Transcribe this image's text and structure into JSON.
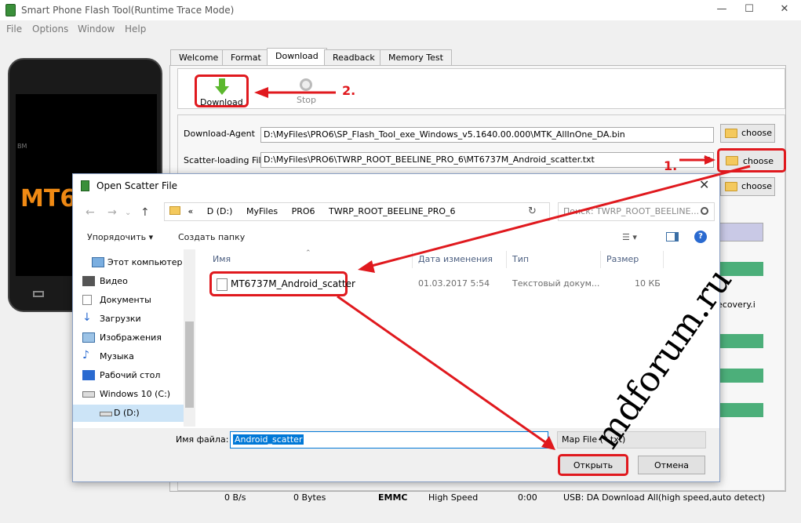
{
  "window": {
    "title": "Smart Phone Flash Tool(Runtime Trace Mode)"
  },
  "menu": [
    "File",
    "Options",
    "Window",
    "Help"
  ],
  "phone": {
    "brand": "BM",
    "chip": "MT6"
  },
  "tabs": [
    "Welcome",
    "Format",
    "Download",
    "Readback",
    "Memory Test"
  ],
  "toolbar": {
    "download": "Download",
    "stop": "Stop"
  },
  "annotations": {
    "step1": "1.",
    "step2": "2."
  },
  "fields": {
    "download_agent_label": "Download-Agent",
    "download_agent_value": "D:\\MyFiles\\PRO6\\SP_Flash_Tool_exe_Windows_v5.1640.00.000\\MTK_AllInOne_DA.bin",
    "scatter_label": "Scatter-loading File",
    "scatter_value": "D:\\MyFiles\\PRO6\\TWRP_ROOT_BEELINE_PRO_6\\MT6737M_Android_scatter.txt",
    "choose": "choose"
  },
  "partition_hint": "ecovery.i",
  "status": {
    "speed": "0 B/s",
    "bytes": "0 Bytes",
    "storage": "EMMC",
    "mode": "High Speed",
    "time": "0:00",
    "usb": "USB: DA Download All(high speed,auto detect)"
  },
  "dialog": {
    "title": "Open Scatter File",
    "path": [
      "«",
      "D (D:)",
      "MyFiles",
      "PRO6",
      "TWRP_ROOT_BEELINE_PRO_6"
    ],
    "search_placeholder": "Поиск: TWRP_ROOT_BEELINE...",
    "organize": "Упорядочить ▾",
    "new_folder": "Создать папку",
    "nav": [
      "Этот компьютер",
      "Видео",
      "Документы",
      "Загрузки",
      "Изображения",
      "Музыка",
      "Рабочий стол",
      "Windows 10 (C:)",
      "D (D:)"
    ],
    "columns": {
      "name": "Имя",
      "date": "Дата изменения",
      "type": "Тип",
      "size": "Размер"
    },
    "file": {
      "name": "MT6737M_Android_scatter",
      "date": "01.03.2017 5:54",
      "type": "Текстовый докум...",
      "size": "10 КБ"
    },
    "filename_label": "Имя файла:",
    "filename_value": "Android_scatter",
    "filetype": "Map File (*.txt)",
    "ok": "Открыть",
    "cancel": "Отмена"
  },
  "watermark": "mdforum.ru",
  "colors": {
    "accent_red": "#e0191e",
    "selection_blue": "#0078d7",
    "row_green": "#4caf7a"
  }
}
